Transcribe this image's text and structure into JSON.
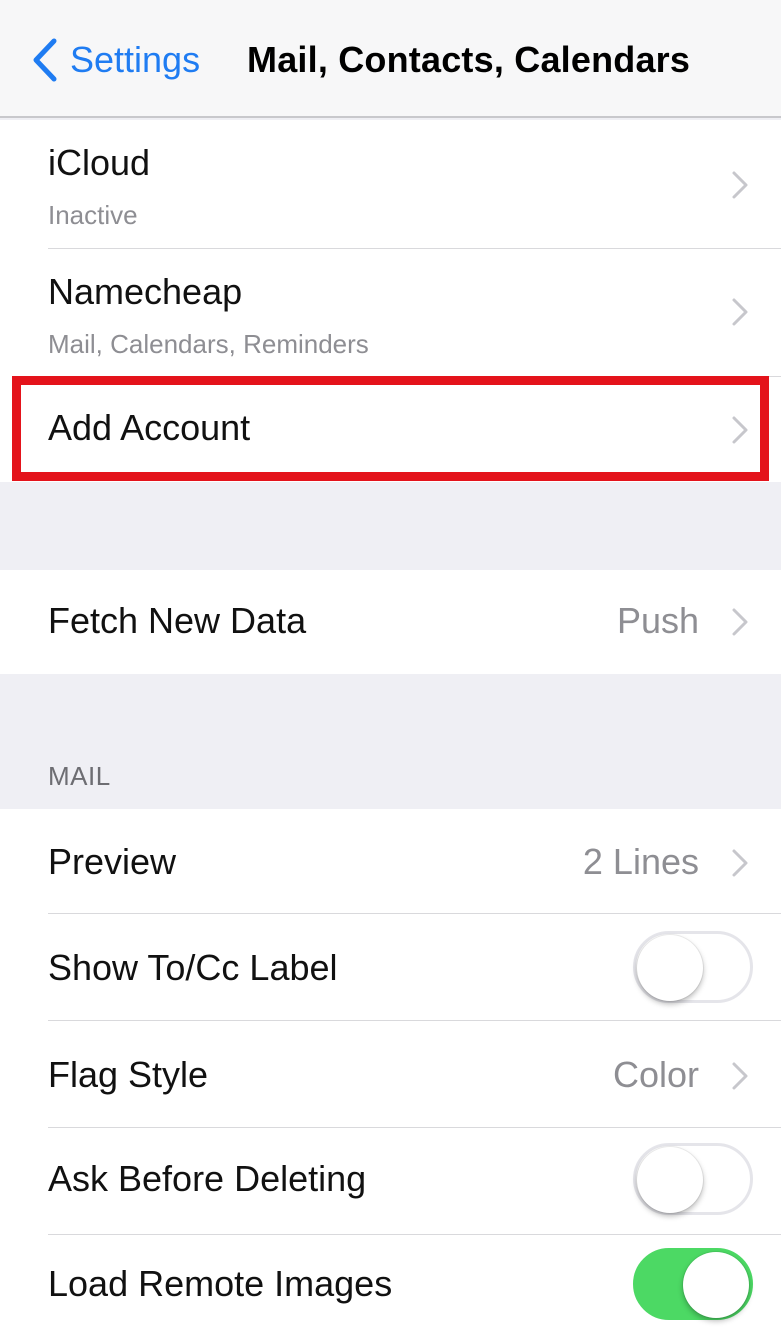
{
  "navbar": {
    "back_label": "Settings",
    "title": "Mail, Contacts, Calendars",
    "accent_color": "#1f7cf2"
  },
  "accounts": [
    {
      "title": "iCloud",
      "subtitle": "Inactive"
    },
    {
      "title": "Namecheap",
      "subtitle": "Mail, Calendars, Reminders"
    }
  ],
  "add_account": {
    "label": "Add Account",
    "highlight_color": "#e4131b"
  },
  "fetch": {
    "label": "Fetch New Data",
    "value": "Push"
  },
  "mail_section": {
    "header": "MAIL",
    "preview": {
      "label": "Preview",
      "value": "2 Lines"
    },
    "show_to_cc": {
      "label": "Show To/Cc Label",
      "enabled": false
    },
    "flag_style": {
      "label": "Flag Style",
      "value": "Color"
    },
    "ask_before_deleting": {
      "label": "Ask Before Deleting",
      "enabled": false
    },
    "load_remote_images": {
      "label": "Load Remote Images",
      "enabled": true
    }
  },
  "icons": {
    "back": "chevron-left-icon",
    "disclosure": "chevron-right-icon"
  },
  "colors": {
    "toggle_on": "#4cd964",
    "secondary_text": "#8e8e93",
    "group_background": "#efeff4"
  }
}
